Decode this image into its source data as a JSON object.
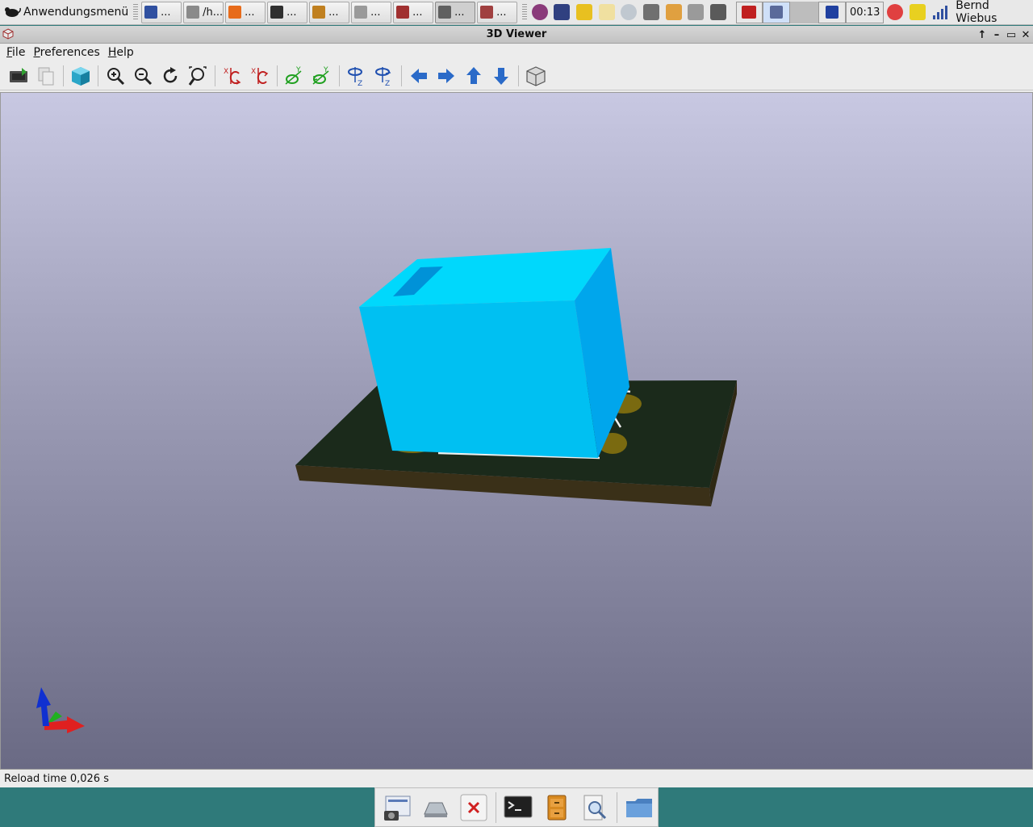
{
  "panel": {
    "app_menu_label": "Anwendungsmenü",
    "tasks": [
      {
        "label": "...",
        "icon": "document-icon",
        "color": "#3050a0"
      },
      {
        "label": "/h...",
        "icon": "mail-icon",
        "color": "#8a8a8a"
      },
      {
        "label": "...",
        "icon": "firefox-icon",
        "color": "#e76b1a"
      },
      {
        "label": "...",
        "icon": "terminal-icon",
        "color": "#303030"
      },
      {
        "label": "...",
        "icon": "schematic-icon",
        "color": "#c08020"
      },
      {
        "label": "...",
        "icon": "window-icon",
        "color": "#9a9a9a"
      },
      {
        "label": "...",
        "icon": "pcb-icon",
        "color": "#a03030"
      },
      {
        "label": "...",
        "icon": "cube-icon",
        "color": "#606060",
        "active": true
      },
      {
        "label": "...",
        "icon": "3d-icon",
        "color": "#a04040"
      }
    ],
    "clock": "00:13",
    "user": "Bernd Wiebus"
  },
  "window": {
    "title": "3D Viewer",
    "menu": [
      {
        "label": "File",
        "mnemonic": "F",
        "rest": "ile"
      },
      {
        "label": "Preferences",
        "mnemonic": "P",
        "rest": "references"
      },
      {
        "label": "Help",
        "mnemonic": "H",
        "rest": "elp"
      }
    ],
    "status": "Reload time 0,026 s"
  },
  "colors": {
    "accent_blue": "#00c8f8",
    "board_dark": "#1b2a1b",
    "board_edge": "#3a3018",
    "pad_gold": "#7a6a10",
    "axis_x": "#e02020",
    "axis_y": "#20b020",
    "axis_z": "#1030d0"
  }
}
